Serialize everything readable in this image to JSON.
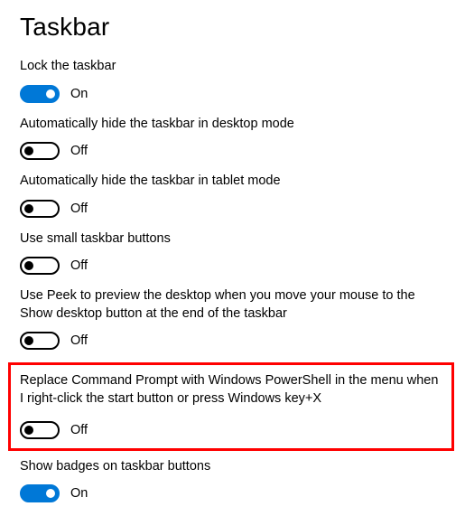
{
  "title": "Taskbar",
  "settings": [
    {
      "label": "Lock the taskbar",
      "state": "On",
      "on": true
    },
    {
      "label": "Automatically hide the taskbar in desktop mode",
      "state": "Off",
      "on": false
    },
    {
      "label": "Automatically hide the taskbar in tablet mode",
      "state": "Off",
      "on": false
    },
    {
      "label": "Use small taskbar buttons",
      "state": "Off",
      "on": false
    },
    {
      "label": "Use Peek to preview the desktop when you move your mouse to the Show desktop button at the end of the taskbar",
      "state": "Off",
      "on": false
    },
    {
      "label": "Replace Command Prompt with Windows PowerShell in the menu when I right-click the start button or press Windows key+X",
      "state": "Off",
      "on": false
    },
    {
      "label": "Show badges on taskbar buttons",
      "state": "On",
      "on": true
    }
  ]
}
